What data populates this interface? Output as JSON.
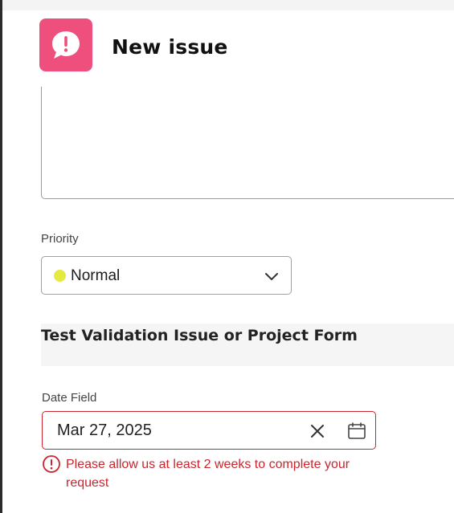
{
  "header": {
    "title": "New issue",
    "app_icon": "speech-bubble-exclamation-icon",
    "app_icon_color": "#ee4f7c"
  },
  "form": {
    "priority": {
      "label": "Priority",
      "value": "Normal",
      "dot_color": "#e4ea3f",
      "icon": "chevron-down-icon"
    },
    "section": {
      "title": "Test Validation Issue or Project Form"
    },
    "date_field": {
      "label": "Date Field",
      "value": "Mar 27, 2025",
      "clear_icon": "close-icon",
      "calendar_icon": "calendar-icon",
      "error_color": "#c9252d",
      "error_message": "Please allow us at least 2 weeks to complete your request"
    }
  }
}
